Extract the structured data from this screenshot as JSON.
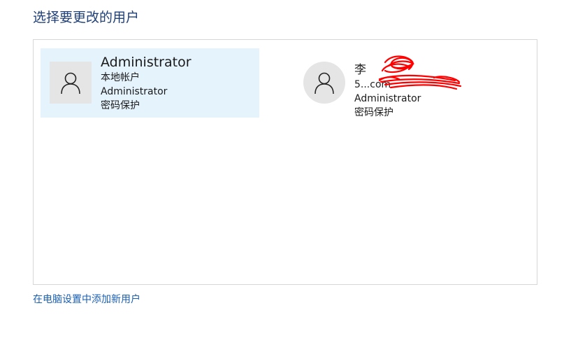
{
  "page": {
    "title": "选择要更改的用户",
    "add_user_link": "在电脑设置中添加新用户"
  },
  "users": [
    {
      "name": "Administrator",
      "account_type": "本地帐户",
      "group": "Administrator",
      "protection": "密码保护",
      "avatar_icon": "user-icon"
    },
    {
      "name": "李",
      "account_type": "5...com",
      "group": "Administrator",
      "protection": "密码保护",
      "avatar_icon": "user-icon",
      "redacted": true
    }
  ],
  "colors": {
    "title": "#1f3f77",
    "link": "#1a5fb4",
    "selected_tile": "#e5f3fd",
    "avatar_bg": "#e5e5e5",
    "redaction": "#ff0000"
  }
}
